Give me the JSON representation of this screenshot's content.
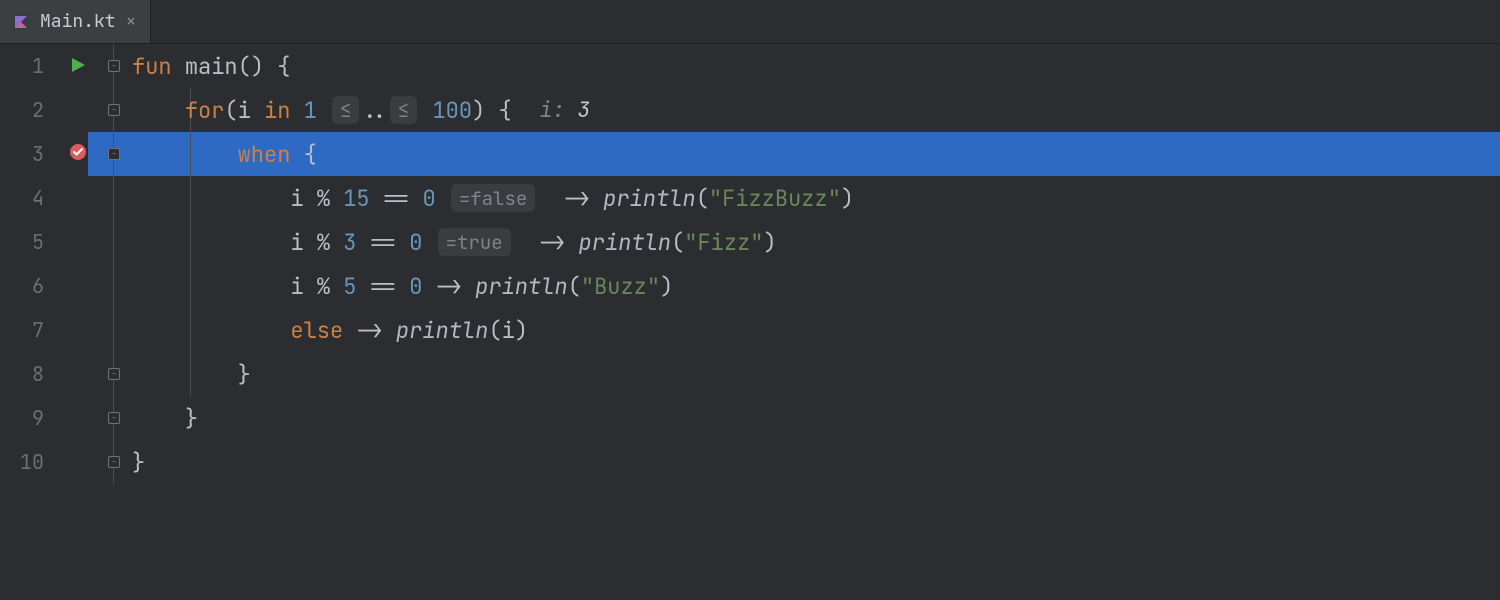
{
  "tab": {
    "filename": "Main.kt",
    "close_glyph": "×"
  },
  "gutter": {
    "line_numbers": [
      "1",
      "2",
      "3",
      "4",
      "5",
      "6",
      "7",
      "8",
      "9",
      "10"
    ],
    "highlighted_line": 3
  },
  "code": {
    "line1": {
      "kw_fun": "fun",
      "name": "main",
      "parens": "()",
      "brace": "{"
    },
    "line2": {
      "kw_for": "for",
      "open": "(",
      "var": "i",
      "kw_in": "in",
      "from": "1",
      "range_left": "≤",
      "range_dots": "..",
      "range_right": "≤",
      "to": "100",
      "close": ")",
      "brace": "{",
      "inlay_var": "i:",
      "inlay_val": "3"
    },
    "line3": {
      "kw_when": "when",
      "brace": "{"
    },
    "line4": {
      "var": "i",
      "mod": "%",
      "divisor": "15",
      "eq": "==",
      "zero": "0",
      "hint_eq": "=",
      "hint_val": "false",
      "arrow": "->",
      "fn": "println",
      "open": "(",
      "quote1": "\"",
      "text": "FizzBuzz",
      "quote2": "\"",
      "close": ")"
    },
    "line5": {
      "var": "i",
      "mod": "%",
      "divisor": "3",
      "eq": "==",
      "zero": "0",
      "hint_eq": "=",
      "hint_val": "true",
      "arrow": "->",
      "fn": "println",
      "open": "(",
      "quote1": "\"",
      "text": "Fizz",
      "quote2": "\"",
      "close": ")"
    },
    "line6": {
      "var": "i",
      "mod": "%",
      "divisor": "5",
      "eq": "==",
      "zero": "0",
      "arrow": "->",
      "fn": "println",
      "open": "(",
      "quote1": "\"",
      "text": "Buzz",
      "quote2": "\"",
      "close": ")"
    },
    "line7": {
      "kw_else": "else",
      "arrow": "->",
      "fn": "println",
      "open": "(",
      "var": "i",
      "close": ")"
    },
    "line8": {
      "brace": "}"
    },
    "line9": {
      "brace": "}"
    },
    "line10": {
      "brace": "}"
    }
  },
  "icons": {
    "kotlin_file": "kotlin-file-icon",
    "run": "run-icon",
    "breakpoint": "breakpoint-verified-icon",
    "fold_open": "−",
    "close": "close-icon"
  }
}
